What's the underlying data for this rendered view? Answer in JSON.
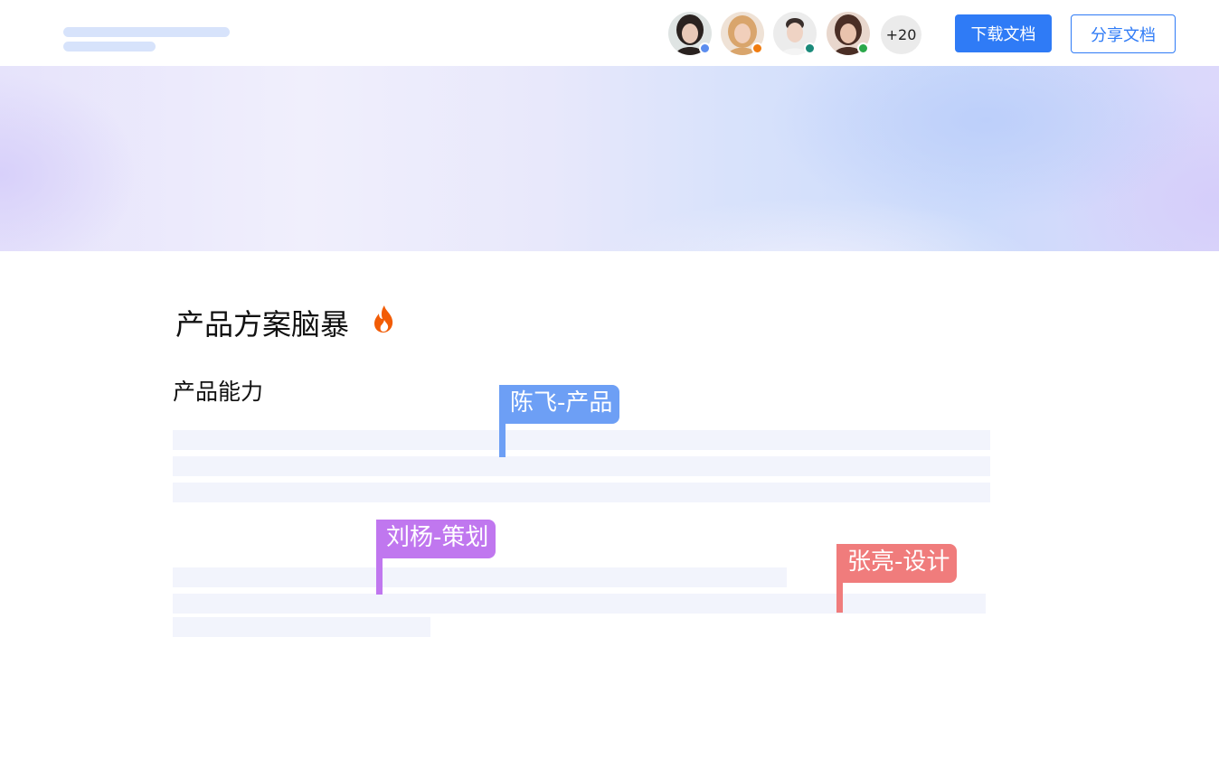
{
  "header": {
    "collaborators": [
      {
        "name": "avatar-1",
        "status_color": "#5b8def",
        "skin": "#e8c9b8",
        "hair": "#2a2220",
        "bg": "#dfe4e3"
      },
      {
        "name": "avatar-2",
        "status_color": "#f07c10",
        "skin": "#f1cfbb",
        "hair": "#d9a56c",
        "bg": "#efe2d6"
      },
      {
        "name": "avatar-3",
        "status_color": "#1a8a7a",
        "skin": "#efd3c4",
        "hair": "#3a2f2c",
        "bg": "#ececec"
      },
      {
        "name": "avatar-4",
        "status_color": "#2aa84a",
        "skin": "#e9c3ad",
        "hair": "#4a2e25",
        "bg": "#e8d7cd"
      }
    ],
    "more_count": "+20",
    "download_label": "下载文档",
    "share_label": "分享文档",
    "primary_color": "#2f7bf6"
  },
  "document": {
    "title": "产品方案脑暴",
    "section_heading": "产品能力"
  },
  "cursors": [
    {
      "label": "陈飞-产品",
      "color": "#6d9ff5"
    },
    {
      "label": "刘杨-策划",
      "color": "#c077ef"
    },
    {
      "label": "张亮-设计",
      "color": "#f07c7c"
    }
  ]
}
